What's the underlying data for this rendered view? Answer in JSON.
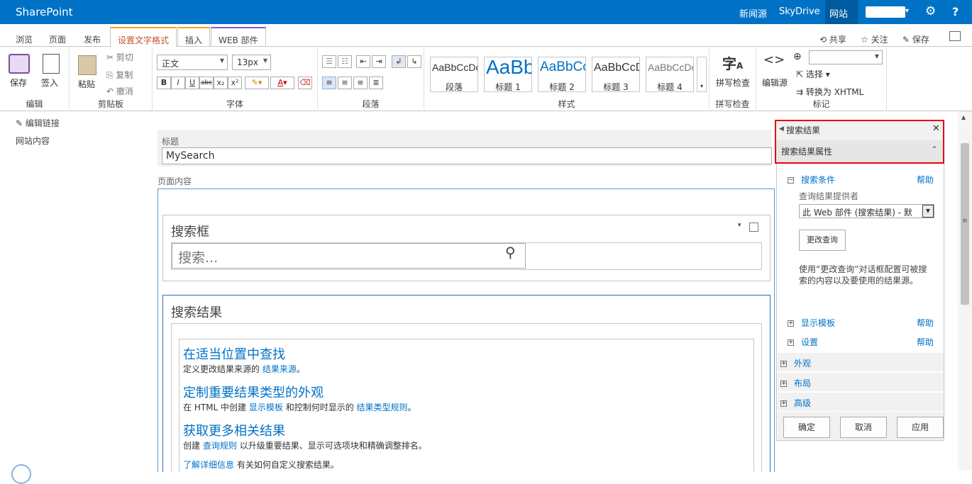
{
  "topbar": {
    "brand": "SharePoint",
    "links": [
      "新闻源",
      "SkyDrive",
      "网站"
    ],
    "user_chevron": "▾",
    "help": "?"
  },
  "tabs": {
    "items": [
      "浏览",
      "页面",
      "发布",
      "设置文字格式",
      "插入",
      "WEB 部件"
    ],
    "actions": {
      "share": "共享",
      "follow": "关注",
      "save": "保存"
    }
  },
  "ribbon": {
    "edit": {
      "save": "保存",
      "checkin": "签入",
      "label": "编辑"
    },
    "clipboard": {
      "paste": "粘贴",
      "cut": "剪切",
      "copy": "复制",
      "undo": "撤消",
      "label": "剪贴板"
    },
    "font": {
      "name": "正文",
      "size": "13px",
      "bold": "B",
      "italic": "I",
      "underline": "U",
      "strike": "abc",
      "sub": "x₂",
      "sup": "x²",
      "label": "字体"
    },
    "paragraph": {
      "label": "段落"
    },
    "styles": {
      "items": [
        {
          "sample": "AaBbCcDc",
          "name": "段落"
        },
        {
          "sample": "AaBb",
          "name": "标题 1"
        },
        {
          "sample": "AaBbCc",
          "name": "标题 2"
        },
        {
          "sample": "AaBbCcD",
          "name": "标题 3"
        },
        {
          "sample": "AaBbCcDc",
          "name": "标题 4"
        }
      ],
      "label": "样式"
    },
    "spelling": {
      "button": "拼写检查",
      "label": "拼写检查"
    },
    "markup": {
      "edit_source": "编辑源",
      "select": "选择",
      "convert": "转换为 XHTML",
      "label": "标记"
    }
  },
  "leftnav": {
    "edit_links": "编辑链接",
    "site_contents": "网站内容"
  },
  "main": {
    "title_label": "标题",
    "title_value": "MySearch",
    "content_label": "页面内容",
    "searchbox": {
      "title": "搜索框",
      "placeholder": "搜索..."
    },
    "results": {
      "title": "搜索结果",
      "item1": {
        "heading": "在适当位置中查找",
        "text": "定义更改结果来源的",
        "link": "结果来源",
        "end": "。"
      },
      "item2": {
        "heading": "定制重要结果类型的外观",
        "text_a": "在 HTML 中创建",
        "link_a": "显示模板",
        "text_b": "和控制何时显示的",
        "link_b": "结果类型规则",
        "end": "。"
      },
      "item3": {
        "heading": "获取更多相关结果",
        "text_a": "创建",
        "link": "查询规则",
        "text_b": "以升级重要结果、显示可选项块和精确调整排名。"
      },
      "learn_more": {
        "link": "了解详细信息",
        "text": "有关如何自定义搜索结果。"
      }
    }
  },
  "panel": {
    "title": "搜索结果",
    "subtitle": "搜索结果属性",
    "criteria": {
      "label": "搜索条件",
      "help": "帮助"
    },
    "provider_label": "查询结果提供者",
    "provider_value": "此 Web 部件 (搜索结果) - 默",
    "change_query": "更改查询",
    "description": "使用“更改查询”对话框配置可被搜索的内容以及要使用的结果源。",
    "display_templates": {
      "label": "显示模板",
      "help": "帮助"
    },
    "settings": {
      "label": "设置",
      "help": "帮助"
    },
    "sections": [
      "外观",
      "布局",
      "高级"
    ],
    "buttons": {
      "ok": "确定",
      "cancel": "取消",
      "apply": "应用"
    }
  }
}
